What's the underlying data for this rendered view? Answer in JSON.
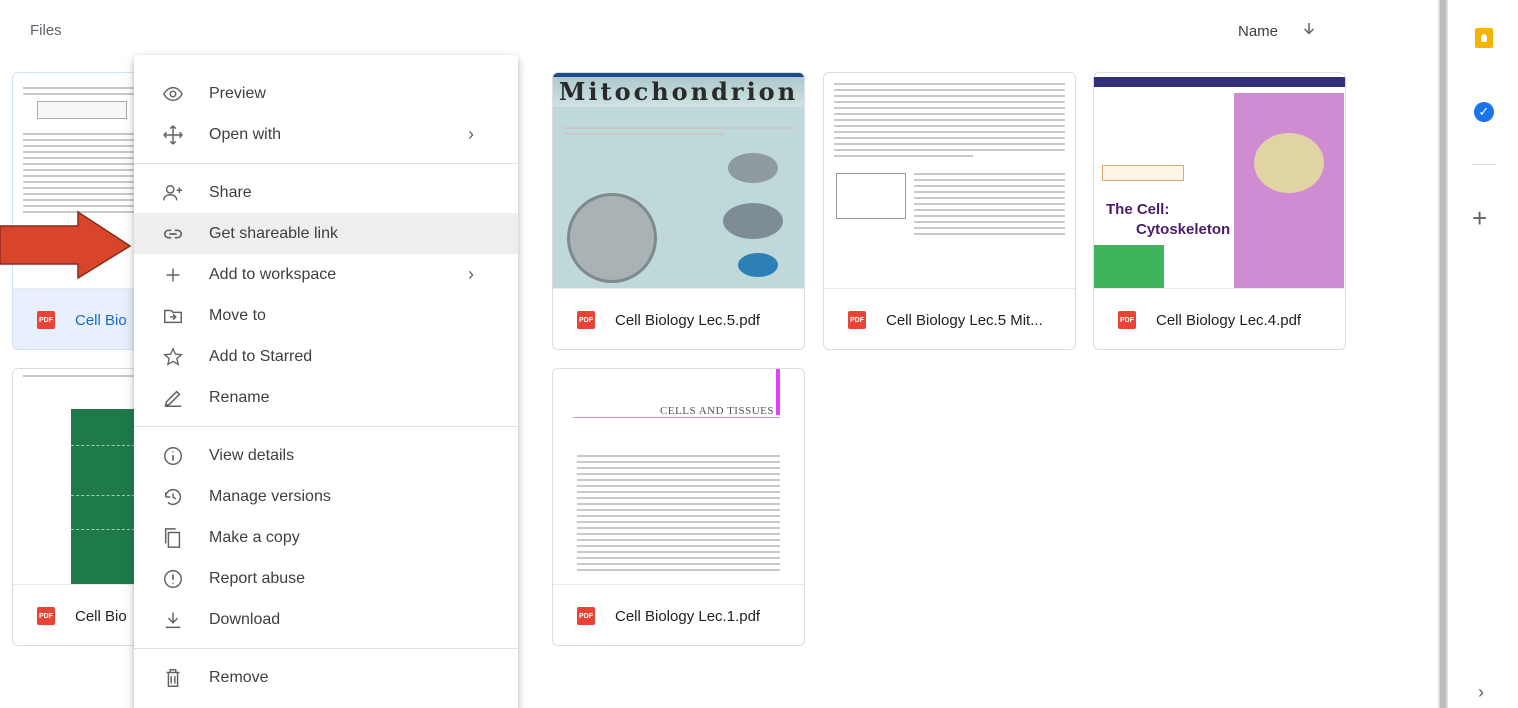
{
  "header": {
    "section_label": "Files",
    "sort_label": "Name"
  },
  "files": [
    {
      "title": "Cell Bio",
      "selected": true
    },
    {
      "title": "Cell Biology Lec.5.pdf",
      "thumb_heading": "Mitochondrion"
    },
    {
      "title": "Cell Biology Lec.5 Mit..."
    },
    {
      "title": "Cell Biology Lec.4.pdf",
      "thumb_heading_1": "The Cell:",
      "thumb_heading_2": "Cytoskeleton"
    },
    {
      "title": "Cell Bio"
    },
    {
      "title": "Cell Biology Lec.1.pdf",
      "thumb_heading": "CELLS AND TISSUES"
    }
  ],
  "menu": {
    "items": [
      {
        "label": "Preview",
        "icon": "eye-icon"
      },
      {
        "label": "Open with",
        "icon": "move-arrows-icon",
        "has_submenu": true
      },
      {
        "label": "Share",
        "icon": "person-add-icon"
      },
      {
        "label": "Get shareable link",
        "icon": "link-icon",
        "highlighted": true
      },
      {
        "label": "Add to workspace",
        "icon": "plus-icon",
        "has_submenu": true
      },
      {
        "label": "Move to",
        "icon": "folder-move-icon"
      },
      {
        "label": "Add to Starred",
        "icon": "star-icon"
      },
      {
        "label": "Rename",
        "icon": "pencil-icon"
      },
      {
        "label": "View details",
        "icon": "info-icon"
      },
      {
        "label": "Manage versions",
        "icon": "history-icon"
      },
      {
        "label": "Make a copy",
        "icon": "copy-icon"
      },
      {
        "label": "Report abuse",
        "icon": "alert-icon"
      },
      {
        "label": "Download",
        "icon": "download-icon"
      },
      {
        "label": "Remove",
        "icon": "trash-icon"
      }
    ]
  },
  "pdf_badge": "PDF",
  "rail": {
    "plus": "+",
    "chevron": "›",
    "tasks_glyph": "✓"
  },
  "colors": {
    "accent": "#1a73e8",
    "pdf": "#ea4335",
    "arrow": "#d9452b"
  }
}
